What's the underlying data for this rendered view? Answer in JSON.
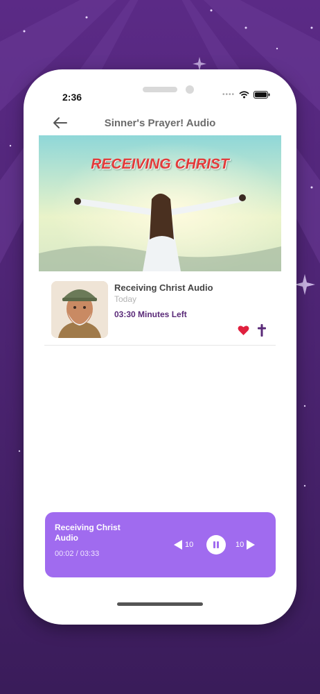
{
  "status_bar": {
    "time": "2:36",
    "signal_icon": "signal-dots-icon",
    "wifi_icon": "wifi-icon",
    "battery_icon": "battery-icon"
  },
  "header": {
    "title": "Sinner's Prayer! Audio",
    "back_icon": "arrow-left-icon"
  },
  "banner": {
    "title": "RECEIVING CHRIST"
  },
  "track": {
    "title": "Receiving Christ Audio",
    "date": "Today",
    "remaining": "03:30 Minutes Left",
    "favorite_icon": "heart-icon",
    "cross_icon": "cross-icon"
  },
  "player": {
    "title": "Receiving Christ Audio",
    "elapsed_total": "00:02 / 03:33",
    "rewind_label": "10",
    "forward_label": "10",
    "progress": 0.01
  },
  "colors": {
    "background": "#4a236f",
    "accent": "#5a2a78",
    "player": "#a06bef",
    "heart": "#e0203e",
    "banner_text": "#e23a3a"
  }
}
